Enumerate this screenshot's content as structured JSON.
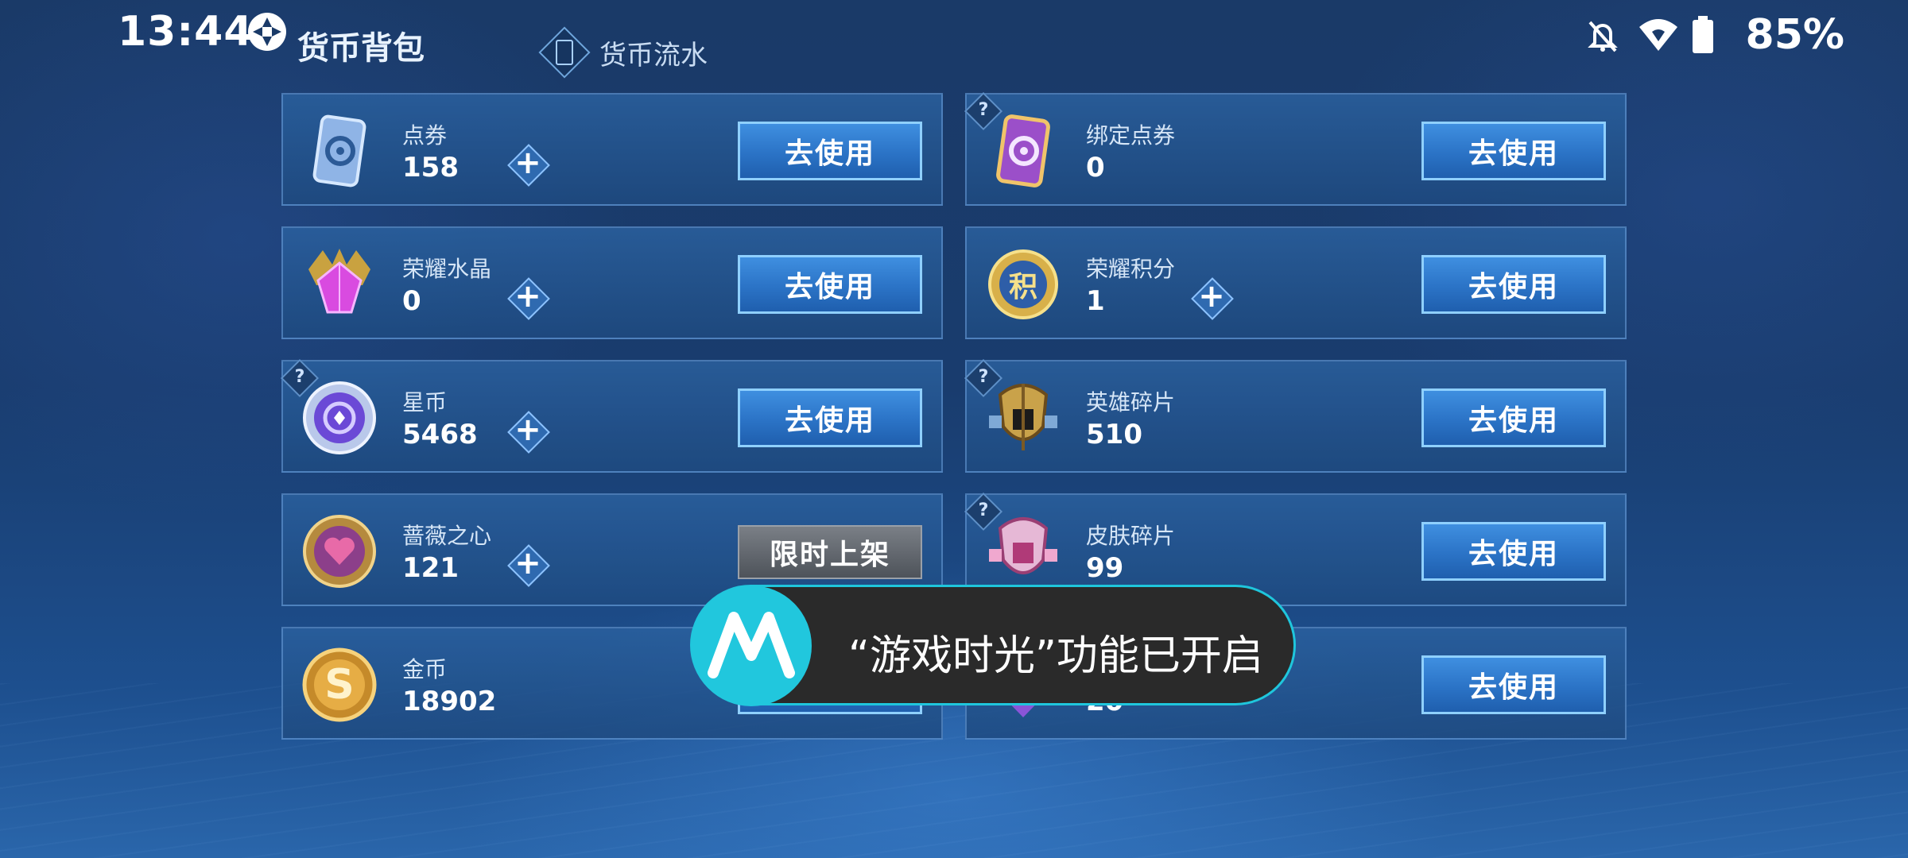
{
  "status": {
    "time": "13:44",
    "battery": "85%"
  },
  "header": {
    "title": "货币背包",
    "history_tab": "货币流水"
  },
  "actions": {
    "use_label": "去使用",
    "limited_label": "限时上架"
  },
  "currencies": [
    {
      "name": "点券",
      "amount": "158"
    },
    {
      "name": "绑定点券",
      "amount": "0"
    },
    {
      "name": "荣耀水晶",
      "amount": "0"
    },
    {
      "name": "荣耀积分",
      "amount": "1",
      "icon_text": "积"
    },
    {
      "name": "星币",
      "amount": "5468"
    },
    {
      "name": "英雄碎片",
      "amount": "510"
    },
    {
      "name": "蔷薇之心",
      "amount": "121"
    },
    {
      "name": "皮肤碎片",
      "amount": "99"
    },
    {
      "name": "金币",
      "amount": "18902",
      "icon_text": "S"
    },
    {
      "name": "",
      "amount": "20"
    }
  ],
  "help_mark": "?",
  "toast": {
    "message": "“游戏时光”功能已开启"
  },
  "colors": {
    "accent": "#2b73c6",
    "toast_border": "#1fc6dc",
    "panel": "#1e4a80"
  }
}
